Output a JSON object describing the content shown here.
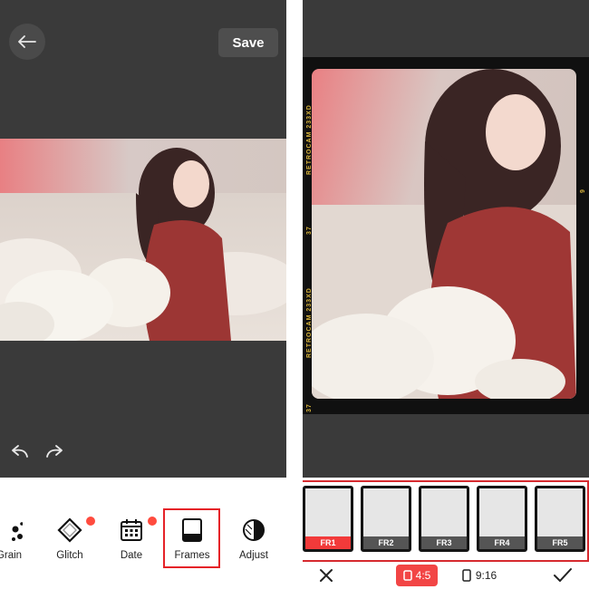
{
  "left_editor": {
    "back_icon": "arrow-left-icon",
    "save_label": "Save",
    "tools": [
      {
        "label": "Grain",
        "icon": "grain-icon",
        "badge": false
      },
      {
        "label": "Glitch",
        "icon": "glitch-icon",
        "badge": true
      },
      {
        "label": "Date",
        "icon": "calendar-icon",
        "badge": true
      },
      {
        "label": "Frames",
        "icon": "frames-icon",
        "badge": false,
        "selected": true
      },
      {
        "label": "Adjust",
        "icon": "adjust-icon",
        "badge": false
      }
    ],
    "undo_icon": "undo-icon",
    "redo_icon": "redo-icon"
  },
  "right_editor": {
    "film_text": {
      "left_top": "RETROCAM 233XD",
      "left_mid": "37",
      "left_bottom": "RETROCAM 233XD",
      "left_end": "37",
      "right_mid": "9"
    },
    "frames": [
      {
        "label": "FR1",
        "selected": true
      },
      {
        "label": "FR2",
        "selected": false
      },
      {
        "label": "FR3",
        "selected": false
      },
      {
        "label": "FR4",
        "selected": false
      },
      {
        "label": "FR5",
        "selected": false
      }
    ],
    "ratios": [
      {
        "label": "4:5",
        "selected": true
      },
      {
        "label": "9:16",
        "selected": false
      }
    ],
    "close_icon": "close-icon",
    "confirm_icon": "check-icon"
  },
  "colors": {
    "accent_red": "#e52228",
    "dark_bg": "#3a3a3a",
    "film_text": "#d6b23a"
  }
}
